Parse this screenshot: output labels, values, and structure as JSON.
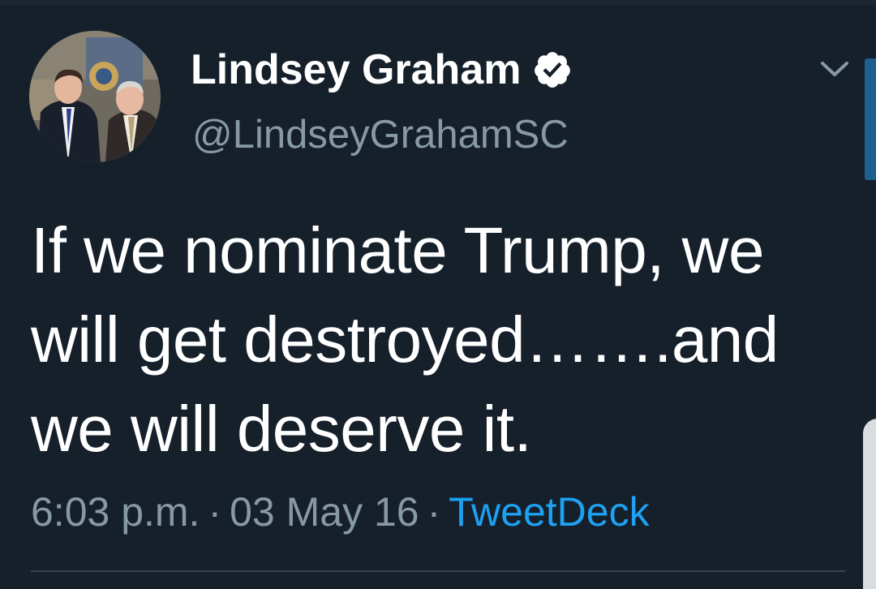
{
  "tweet": {
    "display_name": "Lindsey Graham",
    "handle": "@LindseyGrahamSC",
    "text_lines": [
      "If we nominate Trump, we",
      "will get destroyed…….and",
      "we will deserve it."
    ],
    "time": "6:03 p.m.",
    "separator": "·",
    "date": "03 May 16",
    "source": "TweetDeck",
    "verified": true
  },
  "icons": {
    "verified": "verified-badge-icon",
    "caret": "chevron-down-icon",
    "avatar": "profile-photo"
  },
  "colors": {
    "background": "#15202b",
    "text_primary": "#ffffff",
    "text_secondary": "#8899a6",
    "link": "#1da1f2",
    "divider": "#38444d"
  }
}
